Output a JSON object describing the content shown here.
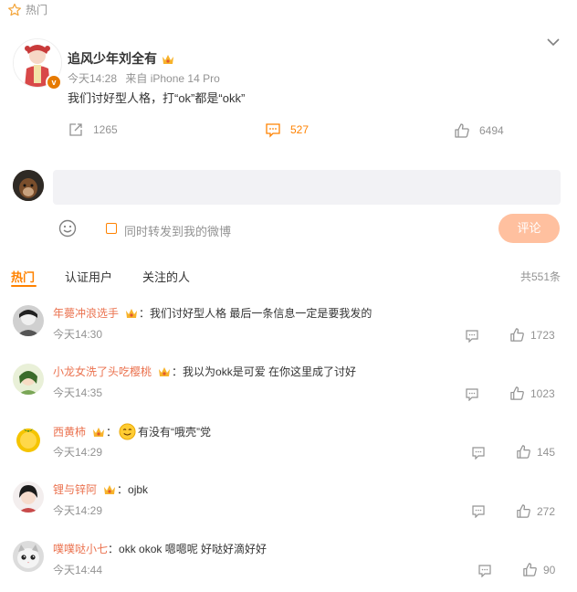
{
  "section": {
    "hot_label": "热门"
  },
  "post": {
    "username": "追风少年刘全有",
    "time": "今天14:28",
    "source": "来自 iPhone 14 Pro",
    "text": "我们讨好型人格，打“ok”都是“okk”",
    "reposts": "1265",
    "comments": "527",
    "likes": "6494",
    "verified_badge": "v"
  },
  "compose": {
    "placeholder": "",
    "repost_checkbox_label": "同时转发到我的微博",
    "submit_label": "评论"
  },
  "tabs": [
    {
      "label": "热门"
    },
    {
      "label": "认证用户"
    },
    {
      "label": "关注的人"
    }
  ],
  "total_label": "共551条",
  "comments": [
    {
      "name": "年薨冲浪选手",
      "sep": "：",
      "text": "我们讨好型人格 最后一条信息一定是要我发的",
      "time": "今天14:30",
      "likes": "1723"
    },
    {
      "name": "小龙女洗了头吃樱桃",
      "sep": "：",
      "text": "我以为okk是可爱 在你这里成了讨好",
      "time": "今天14:35",
      "likes": "1023"
    },
    {
      "name": "西黄柿",
      "sep": "：",
      "text": "有没有“哦壳”党",
      "time": "今天14:29",
      "likes": "145"
    },
    {
      "name": "锂与锌阿",
      "sep": "：",
      "text": "ojbk",
      "time": "今天14:29",
      "likes": "272"
    },
    {
      "name": "噗噗哒小七",
      "sep": "：",
      "text": "okk okok 嗯嗯呢 好哒好滴好好",
      "time": "今天14:44",
      "likes": "90"
    }
  ],
  "colors": {
    "accent": "#ff8200",
    "name": "#eb7350",
    "muted": "#939393",
    "button": "#ffc09f"
  },
  "icons": [
    "star-icon",
    "chevron-down-icon",
    "repost-icon",
    "comment-icon",
    "like-icon",
    "emoji-icon",
    "crown-icon",
    "smile-emoji-icon"
  ]
}
